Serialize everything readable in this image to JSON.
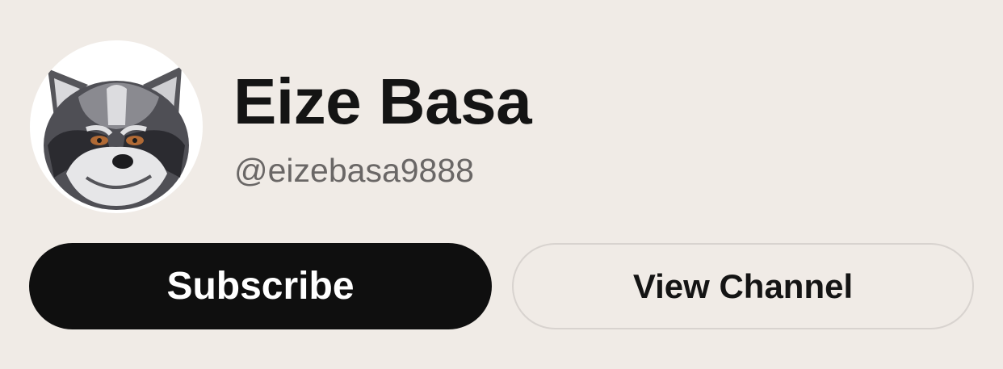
{
  "channel": {
    "name": "Eize Basa",
    "handle": "@eizebasa9888",
    "avatar_icon": "raccoon-avatar"
  },
  "actions": {
    "subscribe_label": "Subscribe",
    "view_channel_label": "View Channel"
  },
  "colors": {
    "background": "#f0ebe6",
    "subscribe_bg": "#0f0f0f",
    "subscribe_text": "#ffffff",
    "view_border": "#d8d3cf",
    "name_text": "#141414",
    "handle_text": "#6a6766"
  }
}
